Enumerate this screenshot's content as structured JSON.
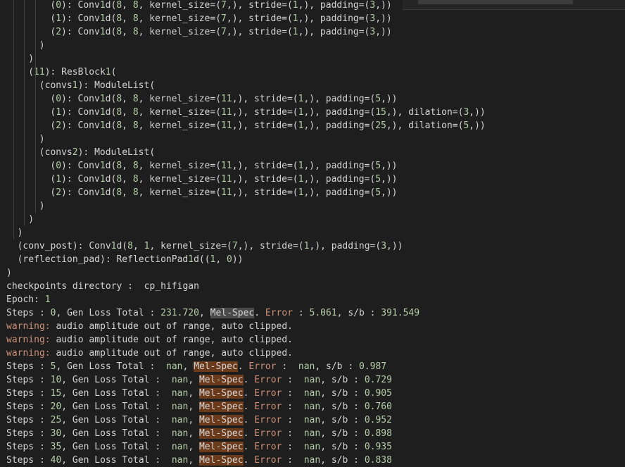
{
  "lines": [
    {
      "indent": 4,
      "text": "(0): Conv1d(8, 8, kernel_size=(7,), stride=(1,), padding=(3,))"
    },
    {
      "indent": 4,
      "text": "(1): Conv1d(8, 8, kernel_size=(7,), stride=(1,), padding=(3,))"
    },
    {
      "indent": 4,
      "text": "(2): Conv1d(8, 8, kernel_size=(7,), stride=(1,), padding=(3,))"
    },
    {
      "indent": 3,
      "text": ")"
    },
    {
      "indent": 2,
      "text": ")"
    },
    {
      "indent": 2,
      "text": "(11): ResBlock1("
    },
    {
      "indent": 3,
      "text": "(convs1): ModuleList("
    },
    {
      "indent": 4,
      "text": "(0): Conv1d(8, 8, kernel_size=(11,), stride=(1,), padding=(5,))"
    },
    {
      "indent": 4,
      "text": "(1): Conv1d(8, 8, kernel_size=(11,), stride=(1,), padding=(15,), dilation=(3,))"
    },
    {
      "indent": 4,
      "text": "(2): Conv1d(8, 8, kernel_size=(11,), stride=(1,), padding=(25,), dilation=(5,))"
    },
    {
      "indent": 3,
      "text": ")"
    },
    {
      "indent": 3,
      "text": "(convs2): ModuleList("
    },
    {
      "indent": 4,
      "text": "(0): Conv1d(8, 8, kernel_size=(11,), stride=(1,), padding=(5,))"
    },
    {
      "indent": 4,
      "text": "(1): Conv1d(8, 8, kernel_size=(11,), stride=(1,), padding=(5,))"
    },
    {
      "indent": 4,
      "text": "(2): Conv1d(8, 8, kernel_size=(11,), stride=(1,), padding=(5,))"
    },
    {
      "indent": 3,
      "text": ")"
    },
    {
      "indent": 2,
      "text": ")"
    },
    {
      "indent": 1,
      "text": ")"
    },
    {
      "indent": 1,
      "text": "(conv_post): Conv1d(8, 1, kernel_size=(7,), stride=(1,), padding=(3,))"
    },
    {
      "indent": 1,
      "text": "(reflection_pad): ReflectionPad1d((1, 0))"
    },
    {
      "indent": 0,
      "text": ")"
    },
    {
      "indent": 0,
      "text": "checkpoints directory :  cp_hifigan"
    },
    {
      "indent": 0,
      "text": "Epoch: 1"
    },
    {
      "indent": 0,
      "kind": "step",
      "step": "0",
      "gen": "231.720",
      "err": "5.061",
      "sb": "391.549",
      "sel": true
    },
    {
      "indent": 0,
      "kind": "warn",
      "text": "audio amplitude out of range, auto clipped."
    },
    {
      "indent": 0,
      "kind": "warn",
      "text": "audio amplitude out of range, auto clipped."
    },
    {
      "indent": 0,
      "kind": "warn",
      "text": "audio amplitude out of range, auto clipped."
    },
    {
      "indent": 0,
      "kind": "step",
      "step": "5",
      "gen": " nan",
      "err": " nan",
      "sb": "0.987"
    },
    {
      "indent": 0,
      "kind": "step",
      "step": "10",
      "gen": " nan",
      "err": " nan",
      "sb": "0.729"
    },
    {
      "indent": 0,
      "kind": "step",
      "step": "15",
      "gen": " nan",
      "err": " nan",
      "sb": "0.905"
    },
    {
      "indent": 0,
      "kind": "step",
      "step": "20",
      "gen": " nan",
      "err": " nan",
      "sb": "0.760"
    },
    {
      "indent": 0,
      "kind": "step",
      "step": "25",
      "gen": " nan",
      "err": " nan",
      "sb": "0.952"
    },
    {
      "indent": 0,
      "kind": "step",
      "step": "30",
      "gen": " nan",
      "err": " nan",
      "sb": "0.898"
    },
    {
      "indent": 0,
      "kind": "step",
      "step": "35",
      "gen": " nan",
      "err": " nan",
      "sb": "0.935"
    },
    {
      "indent": 0,
      "kind": "step",
      "step": "40",
      "gen": " nan",
      "err": " nan",
      "sb": "0.838"
    }
  ],
  "labels": {
    "warning": "warning:",
    "steps": "Steps : ",
    "gen_loss": ", Gen Loss Total : ",
    "mel": "Mel-Spec",
    "error": "Error",
    "sb": ", s/b : "
  },
  "colors": {
    "background": "#1e1e1e",
    "text": "#d4d4d4",
    "number": "#b5cea8",
    "warning": "#ce9178",
    "highlight": "#6b3a1a"
  }
}
